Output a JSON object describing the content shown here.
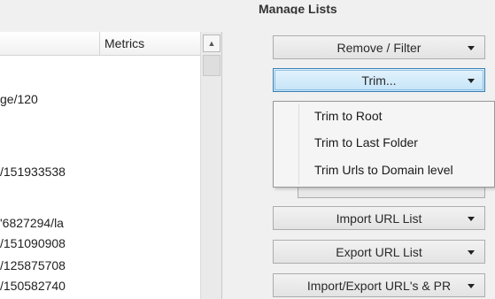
{
  "list": {
    "columns": [
      "",
      "Metrics"
    ],
    "rows": [
      "ge/120",
      "/151933538",
      "'6827294/la",
      "/151090908",
      "/125875708",
      "/150582740"
    ]
  },
  "panel": {
    "title": "Manage Lists",
    "buttons": {
      "remove_filter": "Remove / Filter",
      "trim": "Trim...",
      "import_url_list": "Import URL List",
      "export_url_list": "Export URL List",
      "import_export_pr": "Import/Export URL's & PR"
    },
    "trim_menu": [
      "Trim to Root",
      "Trim to Last Folder",
      "Trim Urls to Domain level"
    ]
  },
  "colors": {
    "active_button": "#c4e4f8",
    "active_border": "#3c7fb1"
  },
  "icons": {
    "scroll_up": "scroll-up-arrow-icon",
    "dropdown": "dropdown-caret-icon"
  }
}
